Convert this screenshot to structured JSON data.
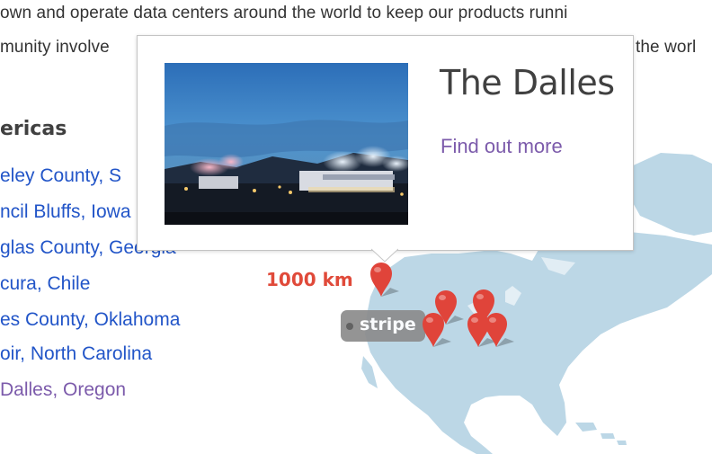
{
  "intro": {
    "line1": "own and operate data centers around the world to keep our products runni",
    "line2": "munity involve",
    "line2_tail": "the worl"
  },
  "locations": {
    "heading": "ericas",
    "items": [
      {
        "label": "eley County, S"
      },
      {
        "label": "ncil Bluffs, Iowa"
      },
      {
        "label": "glas County, Georgia"
      },
      {
        "label": "cura, Chile"
      },
      {
        "label": "es County, Oklahoma"
      },
      {
        "label": "oir, North Carolina"
      },
      {
        "label": "Dalles, Oregon"
      }
    ]
  },
  "popup": {
    "title": "The Dalles",
    "link": "Find out more",
    "photo_icon": "datacenter-night-photo"
  },
  "map": {
    "scale_label": "1000 km",
    "layer_badge": "stripe",
    "land_color": "#bcd7e6",
    "pin_color": "#e0443a",
    "pin_icon": "map-marker-icon"
  },
  "colors": {
    "link": "#2255c8",
    "visited_link": "#7c5bab",
    "heading": "#404040",
    "scale": "#e04a3a"
  }
}
